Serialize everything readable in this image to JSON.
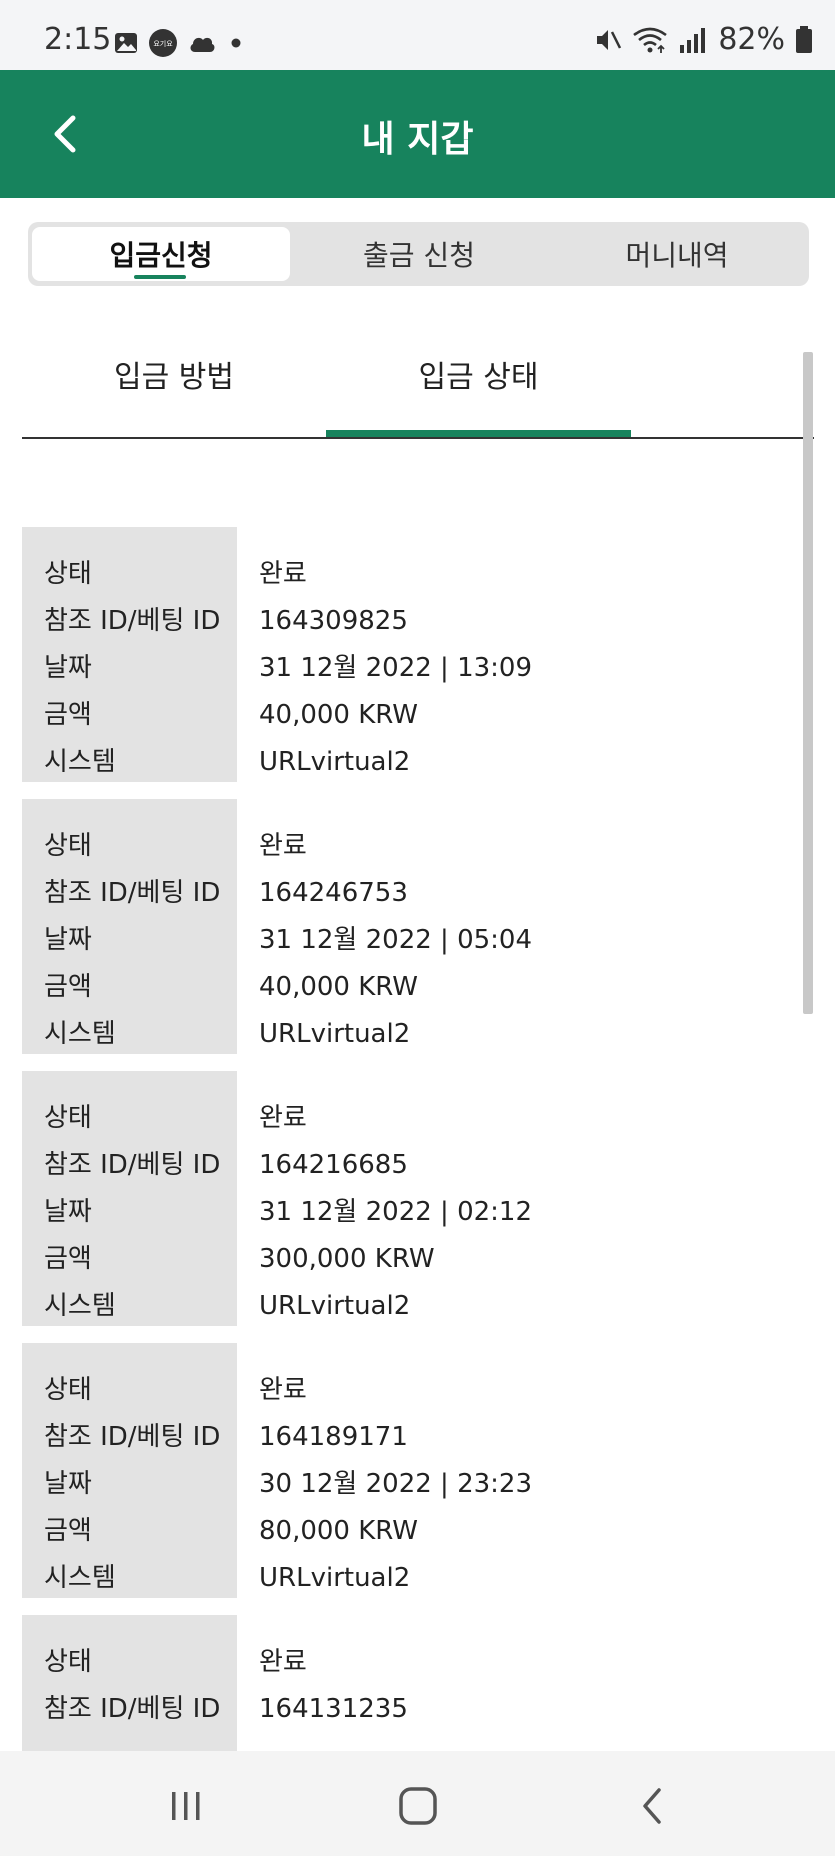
{
  "status_bar": {
    "time": "2:15",
    "badge_text": "요기요",
    "battery": "82%",
    "left_icons": [
      "gallery-icon",
      "app-badge-icon",
      "cloud-icon",
      "dot-icon"
    ],
    "right_icons": [
      "mute-icon",
      "wifi-icon",
      "signal-icon",
      "battery-icon"
    ]
  },
  "header": {
    "title": "내 지갑",
    "back_icon": "chevron-left-icon",
    "color": "#17835d"
  },
  "tabs": [
    {
      "label": "입금신청",
      "active": true
    },
    {
      "label": "출금 신청",
      "active": false
    },
    {
      "label": "머니내역",
      "active": false
    }
  ],
  "sub_tabs": [
    {
      "label": "입금 방법",
      "active": false
    },
    {
      "label": "입금 상태",
      "active": true
    }
  ],
  "field_labels": {
    "status": "상태",
    "ref_id": "참조 ID/베팅 ID",
    "date": "날짜",
    "amount": "금액",
    "system": "시스템"
  },
  "records": [
    {
      "status": "완료",
      "ref_id": "164309825",
      "date": "31 12월 2022 | 13:09",
      "amount": "40,000 KRW",
      "system": "URLvirtual2"
    },
    {
      "status": "완료",
      "ref_id": "164246753",
      "date": "31 12월 2022 | 05:04",
      "amount": "40,000 KRW",
      "system": "URLvirtual2"
    },
    {
      "status": "완료",
      "ref_id": "164216685",
      "date": "31 12월 2022 | 02:12",
      "amount": "300,000 KRW",
      "system": "URLvirtual2"
    },
    {
      "status": "완료",
      "ref_id": "164189171",
      "date": "30 12월 2022 | 23:23",
      "amount": "80,000 KRW",
      "system": "URLvirtual2"
    },
    {
      "status": "완료",
      "ref_id": "164131235"
    }
  ],
  "nav": {
    "recents_icon": "recents-icon",
    "home_icon": "home-icon",
    "back_icon": "back-icon"
  }
}
